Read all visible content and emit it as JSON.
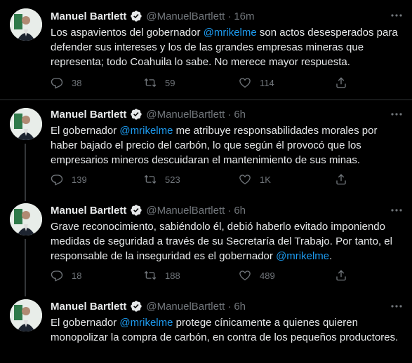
{
  "tweets": [
    {
      "author": "Manuel Bartlett",
      "handle": "@ManuelBartlett",
      "time": "16m",
      "text_before": "Los aspavientos del gobernador ",
      "mention": "@mrikelme",
      "text_after": " son actos desesperados para defender sus intereses y los de las grandes empresas mineras que representa; todo Coahuila lo sabe. No merece mayor respuesta.",
      "replies": "38",
      "retweets": "59",
      "likes": "114"
    },
    {
      "author": "Manuel Bartlett",
      "handle": "@ManuelBartlett",
      "time": "6h",
      "text_before": "El gobernador ",
      "mention": "@mrikelme",
      "text_after": " me atribuye responsabilidades morales por haber bajado el precio del carbón, lo que según él provocó que los empresarios mineros descuidaran el mantenimiento de sus minas.",
      "replies": "139",
      "retweets": "523",
      "likes": "1K"
    },
    {
      "author": "Manuel Bartlett",
      "handle": "@ManuelBartlett",
      "time": "6h",
      "text_before": "Grave reconocimiento, sabiéndolo él, debió haberlo evitado imponiendo medidas de seguridad a través de su Secretaría del Trabajo. Por tanto, el responsable de la inseguridad es el gobernador ",
      "mention": "@mrikelme",
      "text_after": ".",
      "replies": "18",
      "retweets": "188",
      "likes": "489"
    },
    {
      "author": "Manuel Bartlett",
      "handle": "@ManuelBartlett",
      "time": "6h",
      "text_before": "El gobernador ",
      "mention": "@mrikelme",
      "text_after": " protege cínicamente a quienes quieren monopolizar la compra de carbón, en contra de los pequeños productores.",
      "replies": "",
      "retweets": "",
      "likes": ""
    }
  ],
  "separator": "·",
  "icons": {
    "verified": "verified-badge-icon",
    "more": "more-icon",
    "reply": "reply-icon",
    "retweet": "retweet-icon",
    "like": "like-icon",
    "share": "share-icon"
  },
  "colors": {
    "background": "#000000",
    "text": "#e7e9ea",
    "secondary": "#71767b",
    "accent": "#1d9bf0",
    "divider": "#2f3336"
  }
}
